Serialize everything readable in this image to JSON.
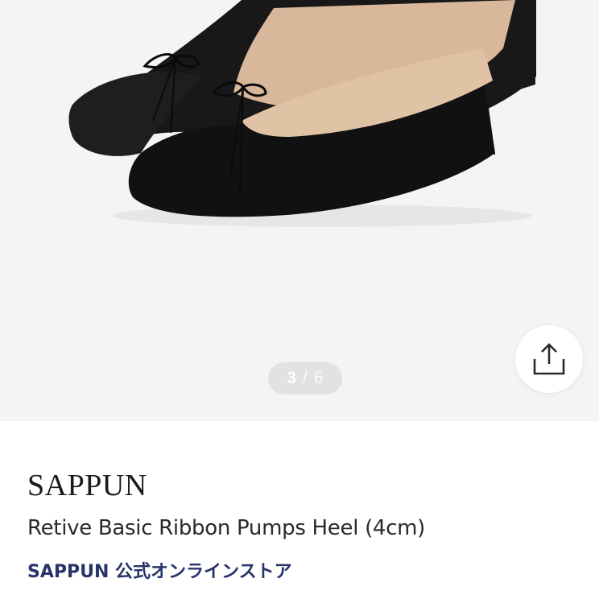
{
  "gallery": {
    "current": "3",
    "separator": "/",
    "total": "6",
    "image": "black-ribbon-pumps-photo"
  },
  "share": {
    "icon": "share-icon"
  },
  "product": {
    "brand": "SAPPUN",
    "name": "Retive Basic Ribbon Pumps Heel (4cm)",
    "store": "SAPPUN 公式オンラインストア"
  },
  "colors": {
    "hero_bg": "#f4f4f4",
    "store_link": "#27336b",
    "pager_bg": "#e2e2e2"
  }
}
